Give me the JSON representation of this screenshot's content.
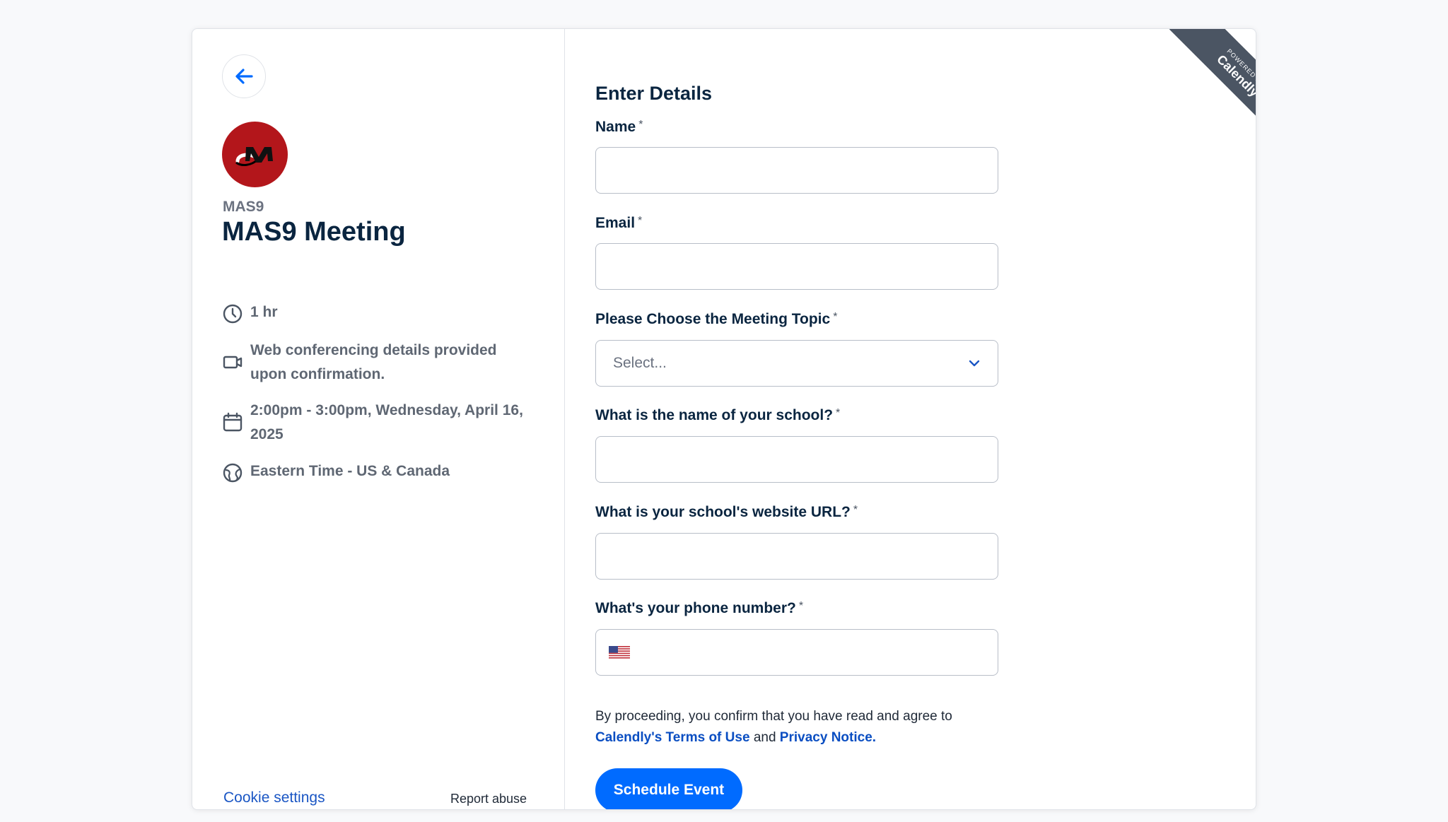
{
  "left": {
    "org_name": "MAS9",
    "event_title": "MAS9 Meeting",
    "avatar_text": "M",
    "details": {
      "duration": "1 hr",
      "conferencing": "Web conferencing details provided upon confirmation.",
      "datetime": "2:00pm - 3:00pm, Wednesday, April 16, 2025",
      "timezone": "Eastern Time - US & Canada"
    },
    "cookie_settings": "Cookie settings",
    "report_abuse": "Report abuse"
  },
  "form": {
    "heading": "Enter Details",
    "required_mark": "*",
    "fields": {
      "name_label": "Name",
      "email_label": "Email",
      "topic_label": "Please Choose the Meeting Topic",
      "topic_placeholder": "Select...",
      "school_label": "What is the name of your school?",
      "url_label": "What is your school's website URL?",
      "phone_label": "What's your phone number?"
    },
    "consent_prefix": "By proceeding, you confirm that you have read and agree to",
    "terms_link": "Calendly's Terms of Use",
    "consent_and": "and",
    "privacy_link": "Privacy Notice.",
    "submit_label": "Schedule Event"
  },
  "ribbon": {
    "small": "POWERED BY",
    "big": "Calendly"
  },
  "colors": {
    "primary": "#006bff",
    "link": "#0a4ec2",
    "avatar_bg": "#b3161b",
    "ribbon_bg": "#4b5563"
  },
  "icons": {
    "back": "arrow-left-icon",
    "duration": "clock-icon",
    "conferencing": "video-camera-icon",
    "datetime": "calendar-icon",
    "timezone": "globe-icon",
    "select": "chevron-down-icon",
    "phone": "us-flag-icon"
  }
}
